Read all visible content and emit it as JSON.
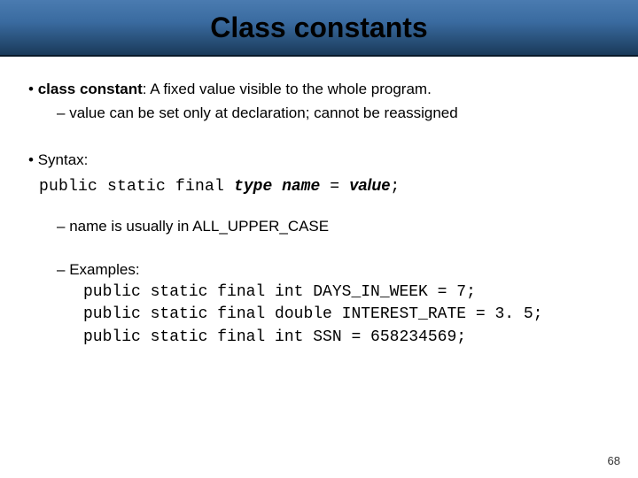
{
  "title": "Class constants",
  "bullet1": {
    "term": "class constant",
    "definition": ": A fixed value visible to the whole program.",
    "sub": "value can be set only at declaration;  cannot be reassigned"
  },
  "syntax": {
    "label": "Syntax:",
    "prefix": "public static final ",
    "type": "type",
    "name": "name",
    "eq": " = ",
    "value": "value",
    "semi": ";"
  },
  "nameNote": "name is usually in ALL_UPPER_CASE",
  "examples": {
    "label": "Examples:",
    "line1": "public static final int DAYS_IN_WEEK = 7;",
    "line2": "public static final double INTEREST_RATE = 3. 5;",
    "line3": "public static final int SSN = 658234569;"
  },
  "pageNumber": "68"
}
